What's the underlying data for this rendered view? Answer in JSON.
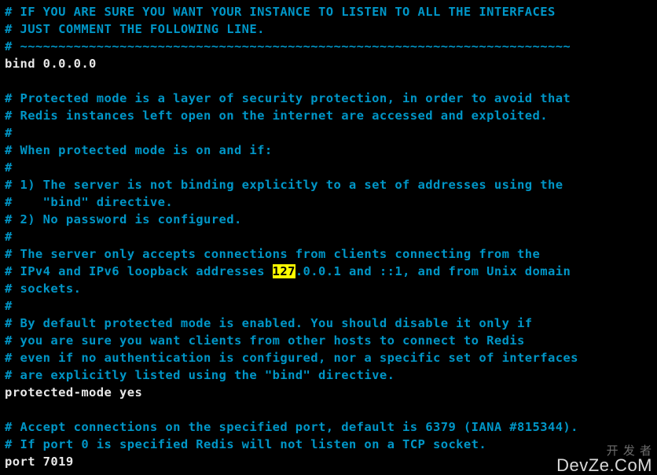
{
  "lines": [
    {
      "t": "comment",
      "v": "# IF YOU ARE SURE YOU WANT YOUR INSTANCE TO LISTEN TO ALL THE INTERFACES"
    },
    {
      "t": "comment",
      "v": "# JUST COMMENT THE FOLLOWING LINE."
    },
    {
      "t": "comment",
      "v": "# ~~~~~~~~~~~~~~~~~~~~~~~~~~~~~~~~~~~~~~~~~~~~~~~~~~~~~~~~~~~~~~~~~~~~~~~~"
    },
    {
      "t": "white",
      "v": "bind 0.0.0.0"
    },
    {
      "t": "blank",
      "v": ""
    },
    {
      "t": "comment",
      "v": "# Protected mode is a layer of security protection, in order to avoid that"
    },
    {
      "t": "comment",
      "v": "# Redis instances left open on the internet are accessed and exploited."
    },
    {
      "t": "comment",
      "v": "#"
    },
    {
      "t": "comment",
      "v": "# When protected mode is on and if:"
    },
    {
      "t": "comment",
      "v": "#"
    },
    {
      "t": "comment",
      "v": "# 1) The server is not binding explicitly to a set of addresses using the"
    },
    {
      "t": "comment",
      "v": "#    \"bind\" directive."
    },
    {
      "t": "comment",
      "v": "# 2) No password is configured."
    },
    {
      "t": "comment",
      "v": "#"
    },
    {
      "t": "comment",
      "v": "# The server only accepts connections from clients connecting from the"
    },
    {
      "t": "hl",
      "pre": "# IPv4 and IPv6 loopback addresses ",
      "hl": "127",
      "post": ".0.0.1 and ::1, and from Unix domain"
    },
    {
      "t": "comment",
      "v": "# sockets."
    },
    {
      "t": "comment",
      "v": "#"
    },
    {
      "t": "comment",
      "v": "# By default protected mode is enabled. You should disable it only if"
    },
    {
      "t": "comment",
      "v": "# you are sure you want clients from other hosts to connect to Redis"
    },
    {
      "t": "comment",
      "v": "# even if no authentication is configured, nor a specific set of interfaces"
    },
    {
      "t": "comment",
      "v": "# are explicitly listed using the \"bind\" directive."
    },
    {
      "t": "white",
      "v": "protected-mode yes"
    },
    {
      "t": "blank",
      "v": ""
    },
    {
      "t": "comment",
      "v": "# Accept connections on the specified port, default is 6379 (IANA #815344)."
    },
    {
      "t": "comment",
      "v": "# If port 0 is specified Redis will not listen on a TCP socket."
    },
    {
      "t": "white",
      "v": "port 7019"
    }
  ],
  "highlight_token": "127",
  "watermark": {
    "top": "开 发 者",
    "bottom": "DevZe.CoM"
  }
}
